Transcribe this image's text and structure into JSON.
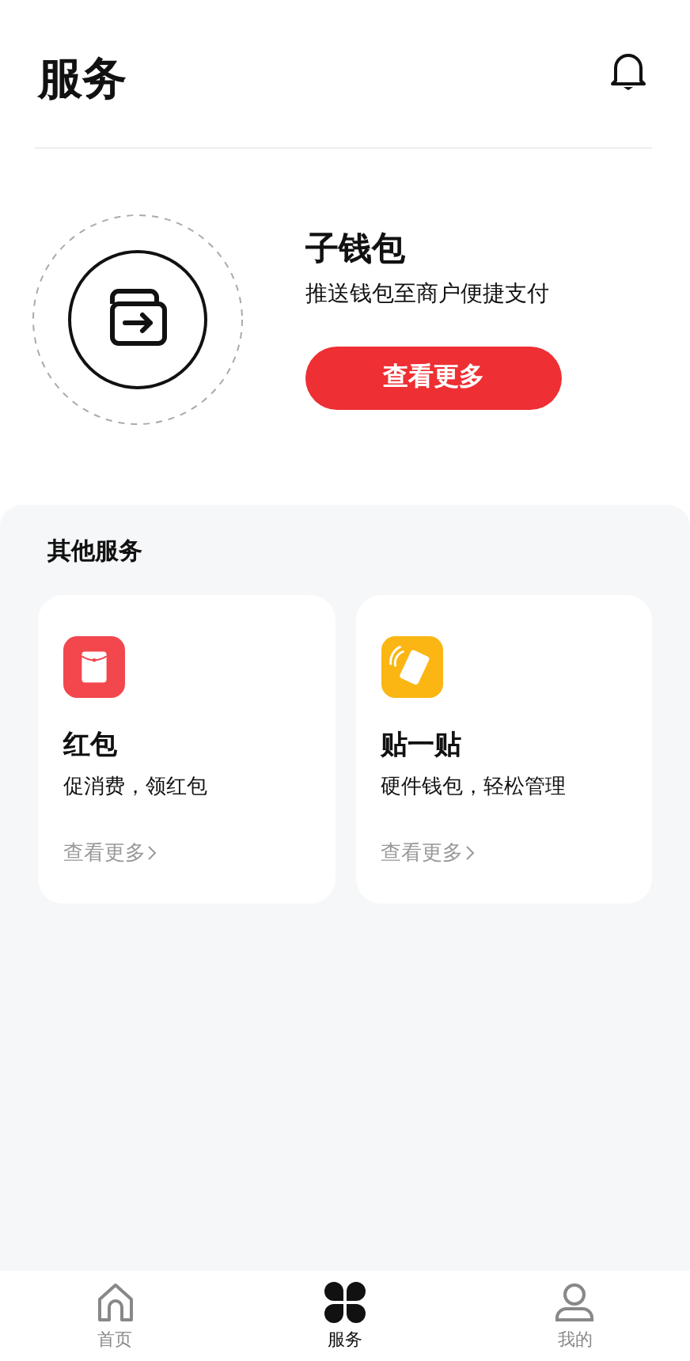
{
  "header": {
    "title": "服务"
  },
  "featured": {
    "title": "子钱包",
    "subtitle": "推送钱包至商户便捷支付",
    "button": "查看更多"
  },
  "other_services": {
    "title": "其他服务",
    "items": [
      {
        "kind": "red_packet",
        "title": "红包",
        "subtitle": "促消费，领红包",
        "link": "查看更多"
      },
      {
        "kind": "tap",
        "title": "贴一贴",
        "subtitle": "硬件钱包，轻松管理",
        "link": "查看更多"
      }
    ]
  },
  "tab_bar": [
    {
      "kind": "home",
      "label": "首页",
      "selected": false
    },
    {
      "kind": "services",
      "label": "服务",
      "selected": true
    },
    {
      "kind": "profile",
      "label": "我的",
      "selected": false
    }
  ]
}
